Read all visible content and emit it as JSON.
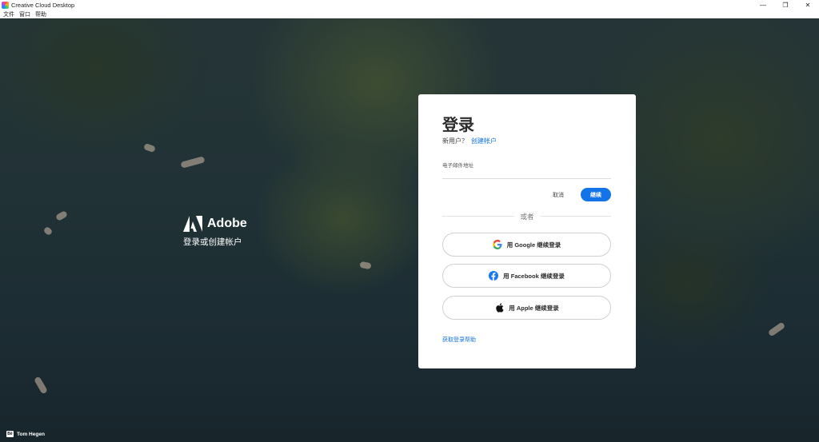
{
  "window": {
    "title": "Creative Cloud Desktop",
    "controls": {
      "minimize": "—",
      "restore": "❐",
      "close": "✕"
    }
  },
  "menu": {
    "items": [
      "文件",
      "窗口",
      "帮助"
    ]
  },
  "brand": {
    "name": "Adobe",
    "tagline": "登录或创建帐户",
    "logo": "adobe-logo-icon"
  },
  "photo_credit": {
    "icon_text": "Bē",
    "name": "Tom Hegen"
  },
  "login": {
    "title": "登录",
    "new_user_prompt": "新用户？",
    "create_account_link": "创建帐户",
    "email_label": "电子邮件地址",
    "email_value": "",
    "cancel_label": "取消",
    "continue_label": "继续",
    "or_text": "或者",
    "social": [
      {
        "label": "用 Google 继续登录",
        "icon": "google-icon"
      },
      {
        "label": "用 Facebook 继续登录",
        "icon": "facebook-icon"
      },
      {
        "label": "用 Apple 继续登录",
        "icon": "apple-icon"
      }
    ],
    "help_link": "获取登录帮助"
  },
  "colors": {
    "accent": "#1473e6",
    "card_bg": "#ffffff",
    "title_text": "#2c2c2c"
  }
}
